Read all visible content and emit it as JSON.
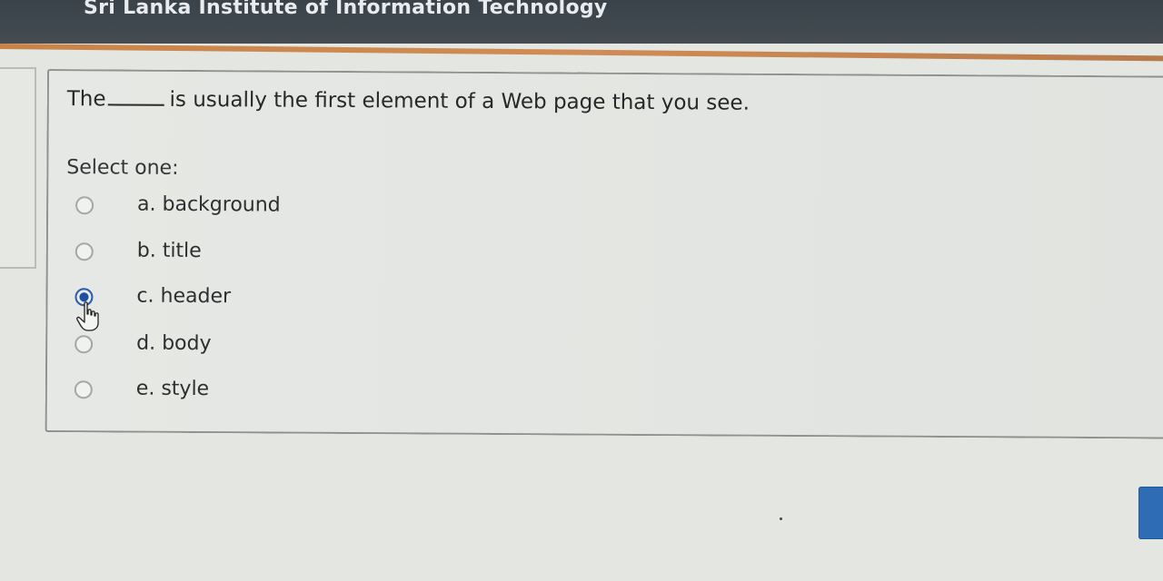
{
  "header": {
    "title": "Sri Lanka Institute of Information Technology"
  },
  "question": {
    "text_before": "The",
    "text_after": "is usually the first element of a Web page that you see.",
    "prompt": "Select one:",
    "options": [
      {
        "label": "a. background",
        "selected": false
      },
      {
        "label": "b. title",
        "selected": false
      },
      {
        "label": "c. header",
        "selected": true
      },
      {
        "label": "d. body",
        "selected": false
      },
      {
        "label": "e. style",
        "selected": false
      }
    ]
  },
  "colors": {
    "header_bg": "#3f484e",
    "accent": "#d18c55",
    "selected_radio": "#2f5ea8",
    "button": "#2e6cb5"
  },
  "icons": {
    "cursor": "hand-pointer-icon"
  }
}
